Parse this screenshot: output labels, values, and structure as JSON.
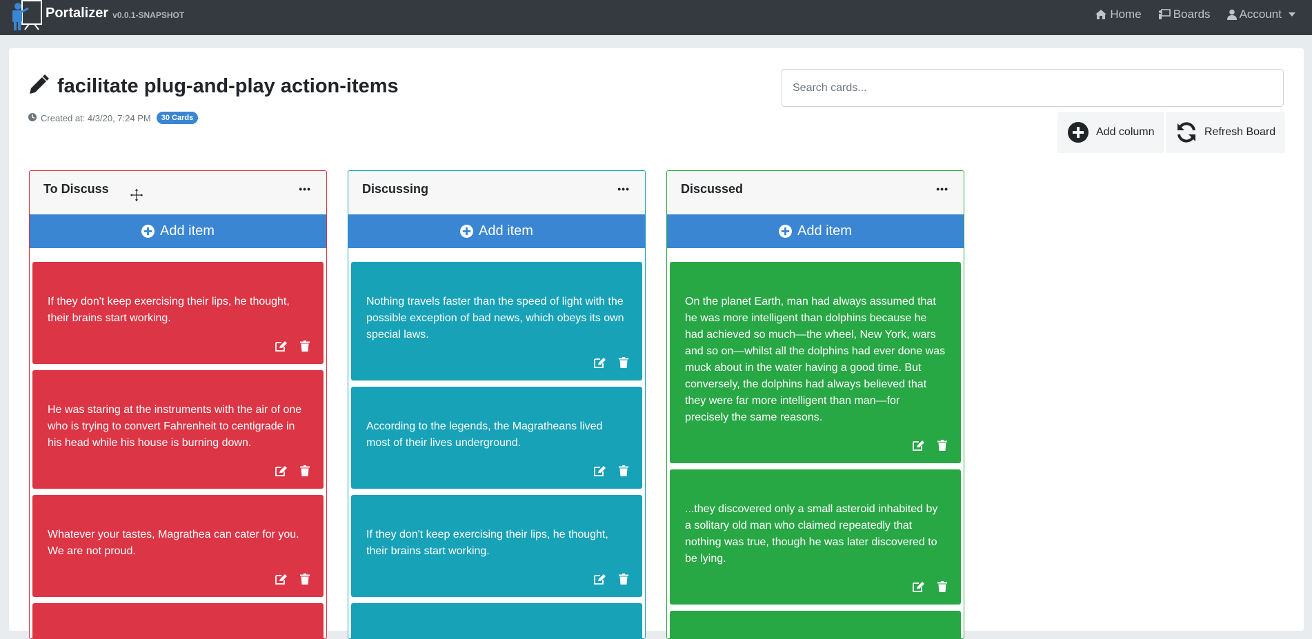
{
  "brand": {
    "name": "Portalizer",
    "version": "v0.0.1-SNAPSHOT"
  },
  "nav": {
    "home": "Home",
    "boards": "Boards",
    "account": "Account"
  },
  "board": {
    "title": "facilitate plug-and-play action-items",
    "created": "Created at: 4/3/20, 7:24 PM",
    "card_count": "30 Cards"
  },
  "search": {
    "placeholder": "Search cards..."
  },
  "toolbar": {
    "add_column": "Add column",
    "refresh": "Refresh Board"
  },
  "colors": {
    "navbar": "#343a40",
    "primary": "#3a86d3",
    "red": "#dc3545",
    "teal": "#17a2b8",
    "green": "#28a745"
  },
  "columns": [
    {
      "title": "To Discuss",
      "more": "•••",
      "add_label": "Add item",
      "cards": [
        "If they don't keep exercising their lips, he thought, their brains start working.",
        "He was staring at the instruments with the air of one who is trying to convert Fahrenheit to centigrade in his head while his house is burning down.",
        "Whatever your tastes, Magrathea can cater for you. We are not proud."
      ]
    },
    {
      "title": "Discussing",
      "more": "•••",
      "add_label": "Add item",
      "cards": [
        "Nothing travels faster than the speed of light with the possible exception of bad news, which obeys its own special laws.",
        "According to the legends, the Magratheans lived most of their lives underground.",
        "If they don't keep exercising their lips, he thought, their brains start working."
      ]
    },
    {
      "title": "Discussed",
      "more": "•••",
      "add_label": "Add item",
      "cards": [
        "On the planet Earth, man had always assumed that he was more intelligent than dolphins because he had achieved so much—the wheel, New York, wars and so on—whilst all the dolphins had ever done was muck about in the water having a good time. But conversely, the dolphins had always believed that they were far more intelligent than man—for precisely the same reasons.",
        "...they discovered only a small asteroid inhabited by a solitary old man who claimed repeatedly that nothing was true, though he was later discovered to be lying."
      ]
    }
  ]
}
